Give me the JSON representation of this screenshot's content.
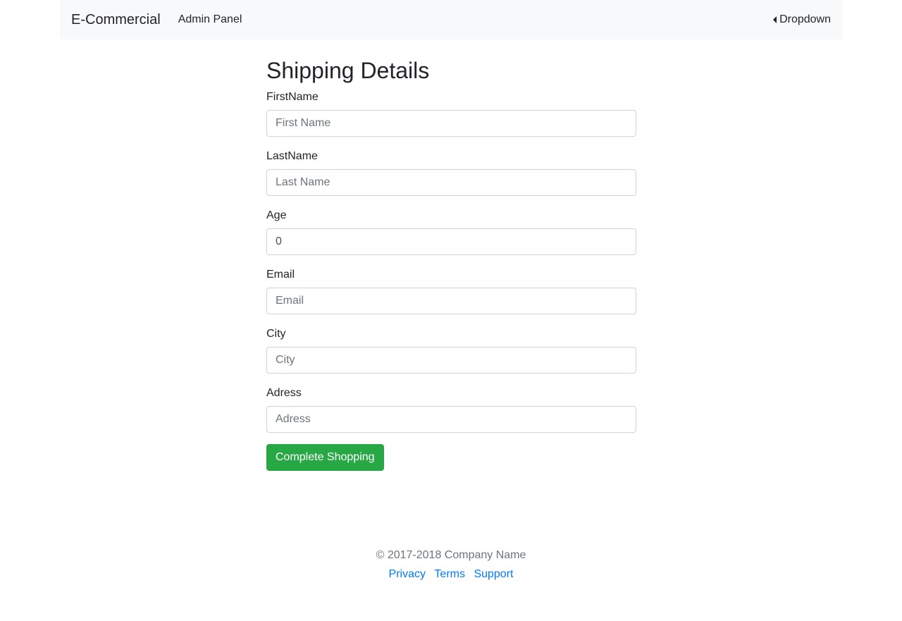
{
  "navbar": {
    "brand": "E-Commercial",
    "admin_link": "Admin Panel",
    "dropdown_label": "Dropdown"
  },
  "form": {
    "title": "Shipping Details",
    "fields": [
      {
        "label": "FirstName",
        "placeholder": "First Name",
        "value": ""
      },
      {
        "label": "LastName",
        "placeholder": "Last Name",
        "value": ""
      },
      {
        "label": "Age",
        "placeholder": "",
        "value": "0"
      },
      {
        "label": "Email",
        "placeholder": "Email",
        "value": ""
      },
      {
        "label": "City",
        "placeholder": "City",
        "value": ""
      },
      {
        "label": "Adress",
        "placeholder": "Adress",
        "value": ""
      }
    ],
    "submit_label": "Complete Shopping"
  },
  "footer": {
    "copyright": "© 2017-2018 Company Name",
    "links": [
      "Privacy",
      "Terms",
      "Support"
    ]
  },
  "colors": {
    "navbar_bg": "#f8f9fa",
    "submit_button": "#28a745",
    "link": "#007bff",
    "muted_text": "#6c757d"
  }
}
